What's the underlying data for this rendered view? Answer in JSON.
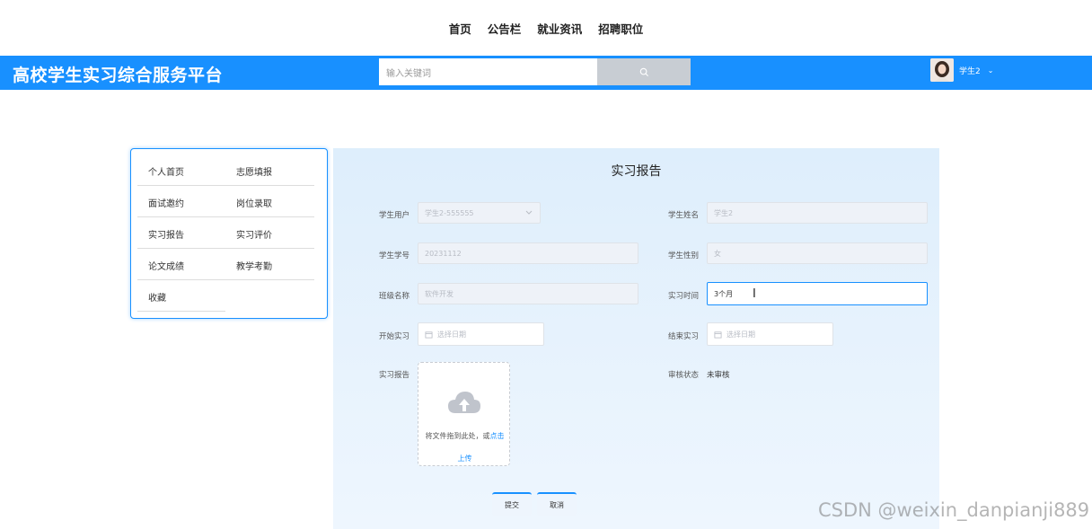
{
  "topnav": {
    "items": [
      "首页",
      "公告栏",
      "就业资讯",
      "招聘职位"
    ]
  },
  "header": {
    "brand": "高校学生实习综合服务平台",
    "search_placeholder": "输入关键词",
    "search_icon": "search-icon",
    "user_name": "学生2",
    "caret": "⌄",
    "brand_color": "#1890ff"
  },
  "sidebar": {
    "items": [
      [
        "个人首页",
        "志愿填报"
      ],
      [
        "面试邀约",
        "岗位录取"
      ],
      [
        "实习报告",
        "实习评价"
      ],
      [
        "论文成绩",
        "教学考勤"
      ],
      [
        "收藏",
        ""
      ]
    ]
  },
  "form": {
    "title": "实习报告",
    "student_user_label": "学生用户",
    "student_user_value": "学生2-555555",
    "student_name_label": "学生姓名",
    "student_name_value": "学生2",
    "student_id_label": "学生学号",
    "student_id_value": "20231112",
    "gender_label": "学生性别",
    "gender_value": "女",
    "class_label": "班级名称",
    "class_value": "软件开发",
    "duration_label": "实习时间",
    "duration_value": "3个月",
    "start_label": "开始实习",
    "start_placeholder": "选择日期",
    "end_label": "结束实习",
    "end_placeholder": "选择日期",
    "report_label": "实习报告",
    "upload_text": "将文件拖到此处，或",
    "upload_link": "点击",
    "upload_text2": "上传",
    "status_label": "审核状态",
    "status_value": "未审核",
    "submit_label": "提交",
    "cancel_label": "取消"
  },
  "watermark": "CSDN @weixin_danpianji889"
}
